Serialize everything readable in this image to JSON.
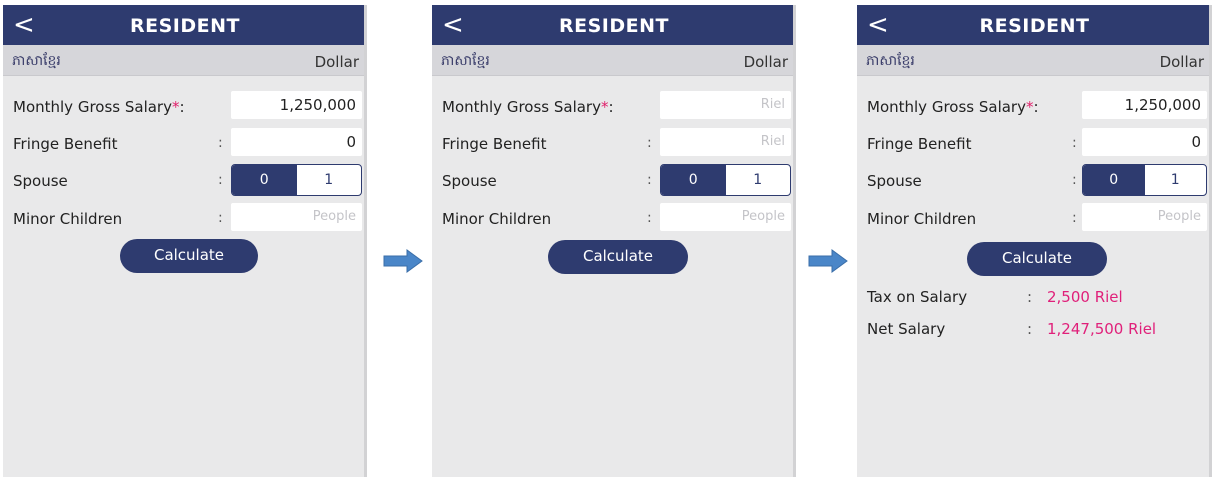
{
  "screens": [
    {
      "nav": {
        "back": "<",
        "title": "RESIDENT"
      },
      "lang": {
        "khmer": "ភាសាខ្មែរ",
        "currency": "Dollar"
      },
      "fields": {
        "monthly_label": "Monthly Gross Salary",
        "star": "*",
        "colon": ":",
        "monthly_value": "1,250,000",
        "fringe_label": "Fringe Benefit",
        "fringe_value": "0",
        "spouse_label": "Spouse",
        "spouse_opt0": "0",
        "spouse_opt1": "1",
        "children_label": "Minor Children",
        "children_placeholder": "People"
      },
      "calculate": "Calculate"
    },
    {
      "nav": {
        "back": "<",
        "title": "RESIDENT"
      },
      "lang": {
        "khmer": "ភាសាខ្មែរ",
        "currency": "Dollar"
      },
      "fields": {
        "monthly_label": "Monthly Gross Salary",
        "star": "*",
        "colon": ":",
        "monthly_placeholder": "Riel",
        "fringe_label": "Fringe Benefit",
        "fringe_placeholder": "Riel",
        "spouse_label": "Spouse",
        "spouse_opt0": "0",
        "spouse_opt1": "1",
        "children_label": "Minor Children",
        "children_placeholder": "People"
      },
      "calculate": "Calculate"
    },
    {
      "nav": {
        "back": "<",
        "title": "RESIDENT"
      },
      "lang": {
        "khmer": "ភាសាខ្មែរ",
        "currency": "Dollar"
      },
      "fields": {
        "monthly_label": "Monthly Gross Salary",
        "star": "*",
        "colon": ":",
        "monthly_value": "1,250,000",
        "fringe_label": "Fringe Benefit",
        "fringe_value": "0",
        "spouse_label": "Spouse",
        "spouse_opt0": "0",
        "spouse_opt1": "1",
        "children_label": "Minor Children",
        "children_placeholder": "People"
      },
      "calculate": "Calculate",
      "results": {
        "tax_label": "Tax on Salary",
        "tax_value": "2,500 Riel",
        "net_label": "Net Salary",
        "net_value": "1,247,500 Riel"
      }
    }
  ],
  "colors": {
    "primary": "#2e3b6f",
    "accent": "#e0207a",
    "arrow": "#4a86c8",
    "background": "#e9e9ea"
  }
}
